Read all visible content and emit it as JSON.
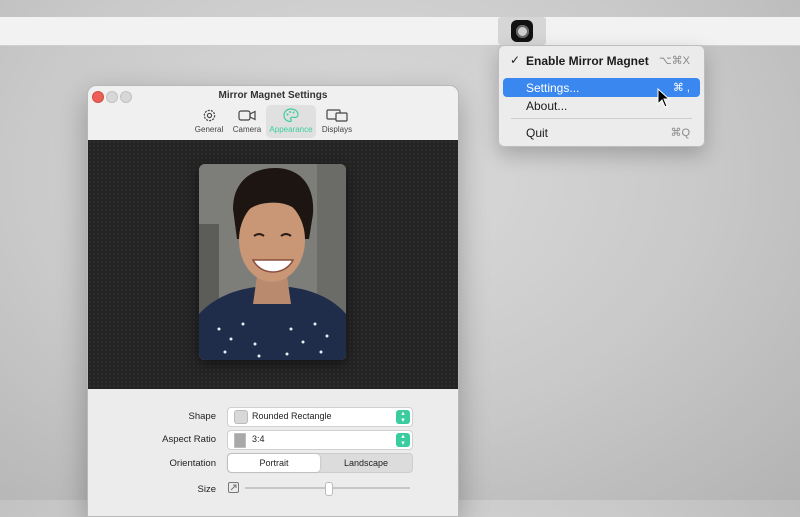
{
  "menubar": {
    "icon": "mirror-magnet-menubar-icon"
  },
  "menu": {
    "items": [
      {
        "label": "Enable Mirror Magnet",
        "shortcut": "⌥⌘X",
        "checked": "✓"
      },
      {
        "label": "Settings...",
        "shortcut": "⌘ ,",
        "highlighted": true
      },
      {
        "label": "About...",
        "shortcut": ""
      },
      {
        "label": "Quit",
        "shortcut": "⌘Q"
      }
    ]
  },
  "window": {
    "title": "Mirror Magnet Settings",
    "tabs": [
      {
        "label": "General",
        "icon": "gear-icon"
      },
      {
        "label": "Camera",
        "icon": "camera-icon"
      },
      {
        "label": "Appearance",
        "icon": "palette-icon",
        "active": true
      },
      {
        "label": "Displays",
        "icon": "displays-icon"
      }
    ],
    "controls": {
      "shape": {
        "label": "Shape",
        "value": "Rounded Rectangle"
      },
      "aspect": {
        "label": "Aspect Ratio",
        "value": "3:4"
      },
      "orientation": {
        "label": "Orientation",
        "options": [
          "Portrait",
          "Landscape"
        ],
        "selected": "Portrait"
      },
      "size": {
        "label": "Size",
        "value_fraction": 0.5
      }
    }
  },
  "colors": {
    "accent": "#3ccf9b",
    "highlight": "#3b87f0"
  }
}
